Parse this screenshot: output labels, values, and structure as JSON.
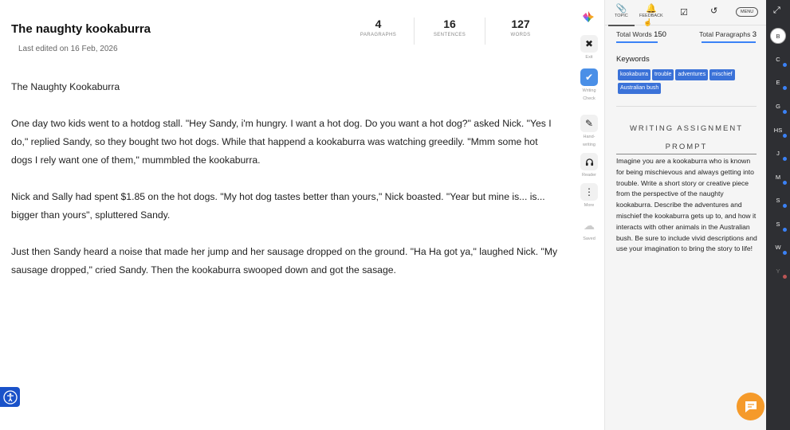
{
  "document": {
    "title": "The naughty kookaburra",
    "last_edited": "Last edited on 16 Feb, 2026",
    "stats": [
      {
        "value": "4",
        "label": "PARAGRAPHS"
      },
      {
        "value": "16",
        "label": "SENTENCES"
      },
      {
        "value": "127",
        "label": "WORDS"
      }
    ],
    "paragraphs": [
      "The Naughty Kookaburra",
      "One day two kids went to a hotdog stall. \"Hey Sandy, i'm hungry. I want a hot dog. Do you want a hot dog?\" asked Nick. \"Yes I do,\" replied Sandy, so they bought two hot dogs. While that happend a kookaburra was watching greedily. \"Mmm some hot dogs I rely want one of them,\" mummbled the kookaburra.",
      "Nick and Sally had spent $1.85 on the hot dogs. \"My hot dog tastes better than yours,\" Nick boasted. \"Year but mine is... is... bigger than yours\", spluttered Sandy.",
      "Just then Sandy heard a noise that made her jump and her sausage dropped on the ground. \"Ha Ha got ya,\" laughed Nick. \"My sausage dropped,\" cried Sandy. Then the kookaburra swooped down and got the sasage."
    ]
  },
  "tools": [
    {
      "label_1": "Exit",
      "label_2": "",
      "icon": "close-icon",
      "glyph": "✖"
    },
    {
      "label_1": "Writing",
      "label_2": "Check",
      "icon": "check-icon",
      "glyph": "✔"
    },
    {
      "label_1": "Hand-",
      "label_2": "writing",
      "icon": "handwriting-icon",
      "glyph": "✎"
    },
    {
      "label_1": "Reader",
      "label_2": "",
      "icon": "headphones-icon",
      "glyph": "🎧"
    },
    {
      "label_1": "More",
      "label_2": "",
      "icon": "more-icon",
      "glyph": "⋮"
    },
    {
      "label_1": "Saved",
      "label_2": "",
      "icon": "cloud-icon",
      "glyph": "☁"
    }
  ],
  "panel": {
    "tabs": {
      "topic": "TOPIC",
      "feedback": "FEEDBACK",
      "menu": "MENU"
    },
    "total_words_label": "Total Words",
    "total_words_value": "150",
    "total_paragraphs_label": "Total Paragraphs",
    "total_paragraphs_value": "3",
    "keywords_title": "Keywords",
    "keywords": [
      "kookaburra",
      "trouble",
      "adventures",
      "mischief",
      "Australian bush"
    ],
    "prompt_title_1": "WRITING ASSIGNMENT",
    "prompt_title_2": "PROMPT",
    "prompt_text": "Imagine you are a kookaburra who is known for being mischievous and always getting into trouble. Write a short story or creative piece from the perspective of the naughty kookaburra. Describe the adventures and mischief the kookaburra gets up to, and how it interacts with other animals in the Australian bush. Be sure to include vivid descriptions and use your imagination to bring the story to life!"
  },
  "rail": {
    "avatars": [
      "B",
      "C",
      "E",
      "G",
      "HS",
      "J",
      "M",
      "S",
      "S",
      "W",
      "Y"
    ]
  },
  "colors": {
    "accent": "#3b72d8",
    "writing_check_active": "#4a8fe7",
    "chat_button": "#f59a2a",
    "accessibility_button": "#1a52c9",
    "rail_bg": "#2e2f33"
  }
}
